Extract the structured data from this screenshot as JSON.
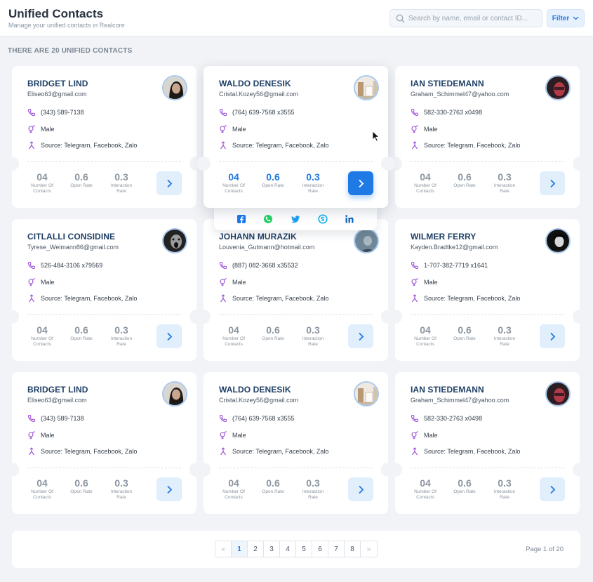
{
  "header": {
    "title": "Unified Contacts",
    "subtitle": "Manage your unified contacts in Realcore",
    "search_placeholder": "Search by name, email or contact ID...",
    "filter_label": "Filter"
  },
  "summary": "THERE ARE 20 UNIFIED CONTACTS",
  "stat_labels": {
    "contacts": "Number Of Contacts",
    "open_rate": "Open Rate",
    "interaction_rate": "Interaction Rate"
  },
  "contacts": [
    {
      "name": "BRIDGET LIND",
      "email": "Eliseo63@gmail.com",
      "phone": "(343) 589-7138",
      "gender": "Male",
      "source": "Source: Telegram, Facebook, Zalo",
      "contacts": "04",
      "open_rate": "0.6",
      "interaction_rate": "0.3",
      "avatar": "portrait-woman-dark"
    },
    {
      "name": "WALDO DENESIK",
      "email": "Cristal.Kozey56@gmail.com",
      "phone": "(764) 639-7568 x3555",
      "gender": "Male",
      "source": "Source: Telegram, Facebook, Zalo",
      "contacts": "04",
      "open_rate": "0.6",
      "interaction_rate": "0.3",
      "avatar": "room-interior"
    },
    {
      "name": "IAN STIEDEMANN",
      "email": "Graham_Schimmel47@yahoo.com",
      "phone": "582-330-2763 x0498",
      "gender": "Male",
      "source": "Source: Telegram, Facebook, Zalo",
      "contacts": "04",
      "open_rate": "0.6",
      "interaction_rate": "0.3",
      "avatar": "portrait-red"
    },
    {
      "name": "CITLALLI CONSIDINE",
      "email": "Tyrese_Weimann86@gmail.com",
      "phone": "526-484-3106 x79569",
      "gender": "Male",
      "source": "Source: Telegram, Facebook, Zalo",
      "contacts": "04",
      "open_rate": "0.6",
      "interaction_rate": "0.3",
      "avatar": "portrait-screaming"
    },
    {
      "name": "JOHANN MURAZIK",
      "email": "Louvenia_Gutmann@hotmail.com",
      "phone": "(887) 082-3668 x35532",
      "gender": "Male",
      "source": "Source: Telegram, Facebook, Zalo",
      "contacts": "04",
      "open_rate": "0.6",
      "interaction_rate": "0.3",
      "avatar": "portrait-outdoor"
    },
    {
      "name": "WILMER FERRY",
      "email": "Kayden.Bradtke12@gmail.com",
      "phone": "1-707-382-7719 x1641",
      "gender": "Male",
      "source": "Source: Telegram, Facebook, Zalo",
      "contacts": "04",
      "open_rate": "0.6",
      "interaction_rate": "0.3",
      "avatar": "portrait-bw"
    },
    {
      "name": "BRIDGET LIND",
      "email": "Eliseo63@gmail.com",
      "phone": "(343) 589-7138",
      "gender": "Male",
      "source": "Source: Telegram, Facebook, Zalo",
      "contacts": "04",
      "open_rate": "0.6",
      "interaction_rate": "0.3",
      "avatar": "portrait-woman-dark"
    },
    {
      "name": "WALDO DENESIK",
      "email": "Cristal.Kozey56@gmail.com",
      "phone": "(764) 639-7568 x3555",
      "gender": "Male",
      "source": "Source: Telegram, Facebook, Zalo",
      "contacts": "04",
      "open_rate": "0.6",
      "interaction_rate": "0.3",
      "avatar": "room-interior"
    },
    {
      "name": "IAN STIEDEMANN",
      "email": "Graham_Schimmel47@yahoo.com",
      "phone": "582-330-2763 x0498",
      "gender": "Male",
      "source": "Source: Telegram, Facebook, Zalo",
      "contacts": "04",
      "open_rate": "0.6",
      "interaction_rate": "0.3",
      "avatar": "portrait-red"
    }
  ],
  "social_icons": [
    "facebook-icon",
    "whatsapp-icon",
    "twitter-icon",
    "skype-icon",
    "linkedin-icon"
  ],
  "social_colors": {
    "facebook": "#1877f2",
    "whatsapp": "#25d366",
    "twitter": "#1da1f2",
    "skype": "#00aff0",
    "linkedin": "#0a66c2"
  },
  "pagination": {
    "prev": "«",
    "pages": [
      "1",
      "2",
      "3",
      "4",
      "5",
      "6",
      "7",
      "8"
    ],
    "next": "»",
    "current": "1",
    "info": "Page 1 of 20"
  },
  "colors": {
    "accent": "#1f7ae6",
    "name": "#1e3f66",
    "icon_purple": "#9b4dd6"
  }
}
